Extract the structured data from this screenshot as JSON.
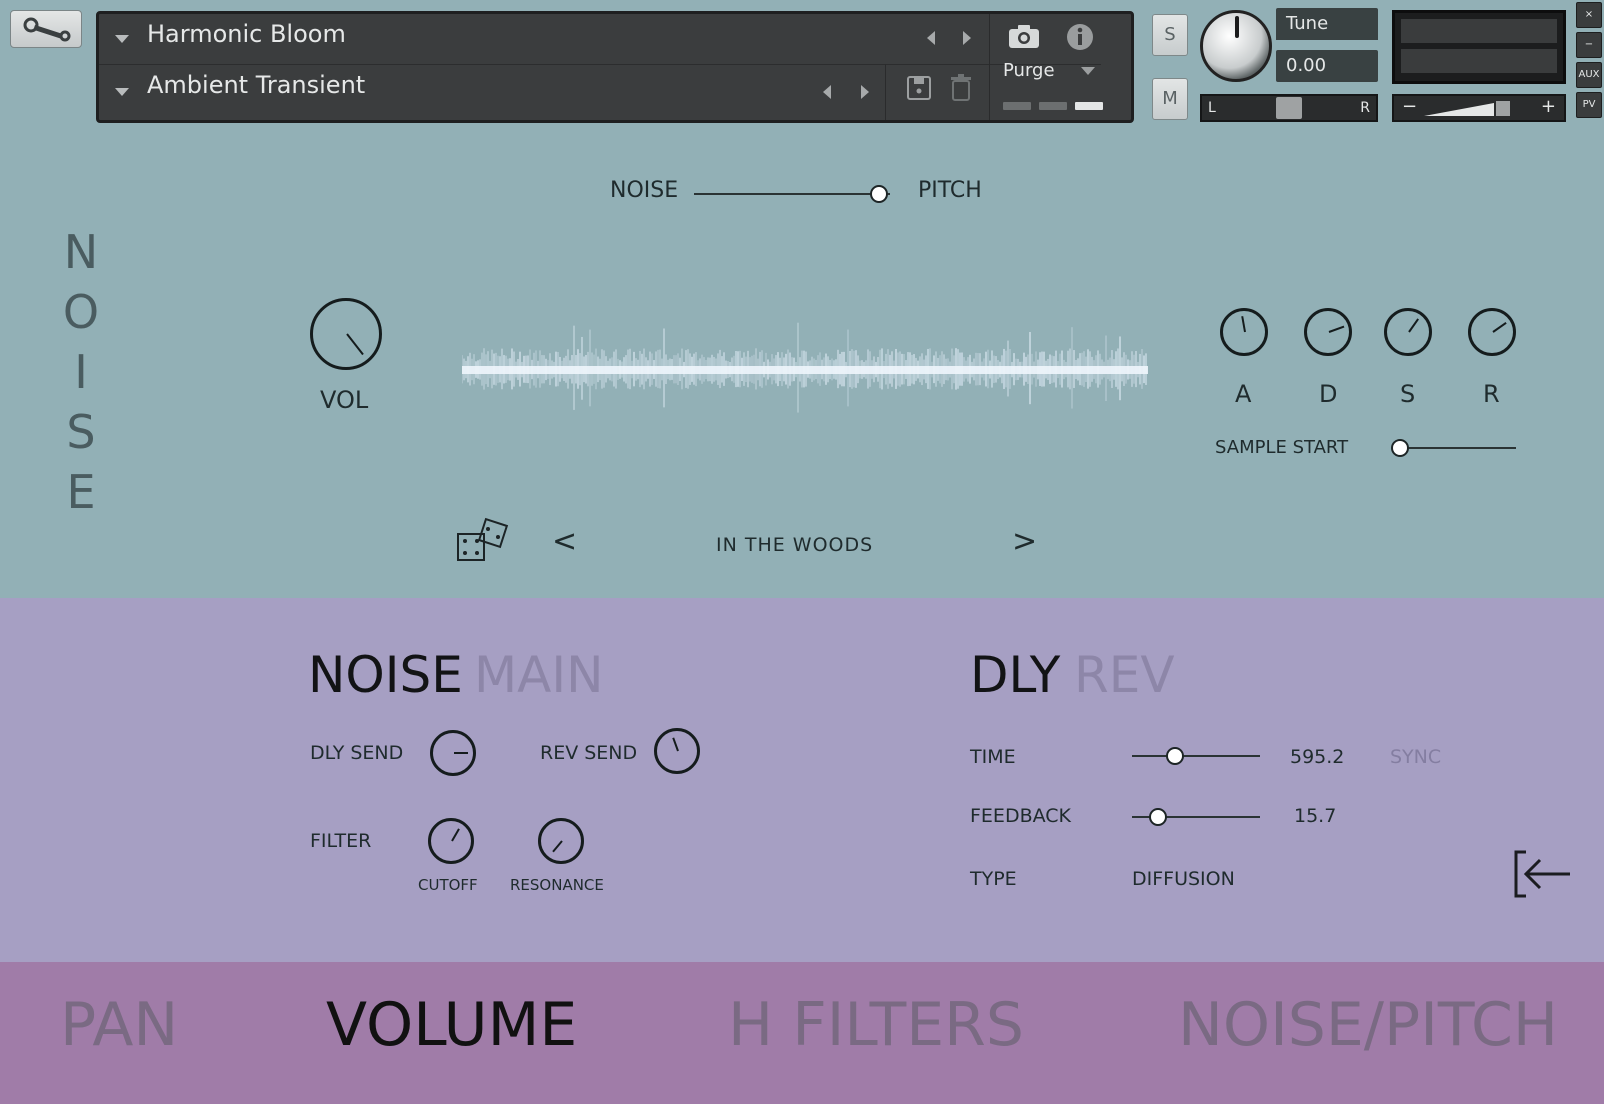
{
  "header": {
    "instrument_name": "Harmonic Bloom",
    "preset_name": "Ambient Transient",
    "purge_label": "Purge",
    "solo_label": "S",
    "mute_label": "M",
    "tune_label": "Tune",
    "tune_value": "0.00",
    "pan_left": "L",
    "pan_right": "R",
    "vol_minus": "−",
    "vol_plus": "+",
    "side": {
      "close": "×",
      "min": "−",
      "aux": "AUX",
      "pv": "PV"
    }
  },
  "noise_panel": {
    "vertical_title": [
      "N",
      "O",
      "I",
      "S",
      "E"
    ],
    "mode_left": "NOISE",
    "mode_right": "PITCH",
    "vol_label": "VOL",
    "adsr": [
      "A",
      "D",
      "S",
      "R"
    ],
    "sample_start_label": "SAMPLE START",
    "prev_symbol": "<",
    "next_symbol": ">",
    "sample_name": "IN THE WOODS"
  },
  "main_section": {
    "title_active": "NOISE",
    "title_inactive": "MAIN",
    "dly_send": "DLY SEND",
    "rev_send": "REV SEND",
    "filter": "FILTER",
    "cutoff": "CUTOFF",
    "resonance": "RESONANCE"
  },
  "fx_section": {
    "title_active": "DLY",
    "title_inactive": "REV",
    "time_label": "TIME",
    "time_value": "595.2",
    "sync_label": "SYNC",
    "feedback_label": "FEEDBACK",
    "feedback_value": "15.7",
    "type_label": "TYPE",
    "type_value": "DIFFUSION"
  },
  "tabs": [
    "PAN",
    "VOLUME",
    "H FILTERS",
    "NOISE/PITCH"
  ],
  "colors": {
    "teal_bg": "#92b0b6",
    "purple_mid": "#a69fc3",
    "purple_tabs": "#a07ca8",
    "tab_active": "#111111",
    "tab_inactive": "#7a6a83"
  }
}
